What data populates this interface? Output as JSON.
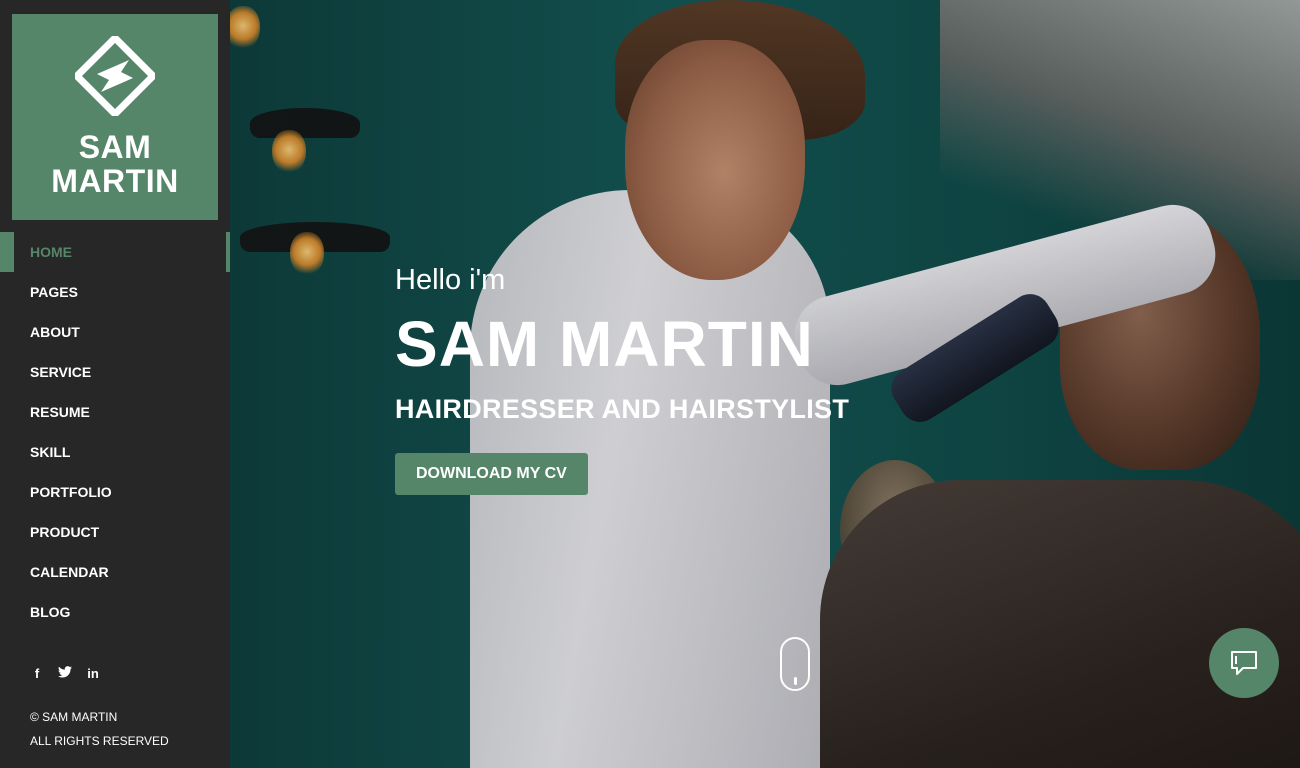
{
  "brand": {
    "name_line1": "SAM",
    "name_line2": "MARTIN",
    "logo_icon": "diamond-s-logo-icon",
    "accent_color": "#568669"
  },
  "nav": {
    "items": [
      {
        "label": "HOME",
        "active": true
      },
      {
        "label": "PAGES",
        "active": false
      },
      {
        "label": "ABOUT",
        "active": false
      },
      {
        "label": "SERVICE",
        "active": false
      },
      {
        "label": "RESUME",
        "active": false
      },
      {
        "label": "SKILL",
        "active": false
      },
      {
        "label": "PORTFOLIO",
        "active": false
      },
      {
        "label": "PRODUCT",
        "active": false
      },
      {
        "label": "CALENDAR",
        "active": false
      },
      {
        "label": "BLOG",
        "active": false
      }
    ]
  },
  "social": {
    "facebook": "f",
    "twitter_icon": "twitter-icon",
    "linkedin": "in"
  },
  "footer": {
    "copyright": "© SAM MARTIN",
    "rights": "ALL RIGHTS RESERVED"
  },
  "hero": {
    "greeting": "Hello i'm",
    "name": "SAM MARTIN",
    "subtitle": "HAIRDRESSER AND HAIRSTYLIST",
    "cta_label": "DOWNLOAD MY CV"
  },
  "widgets": {
    "scroll_icon": "mouse-scroll-icon",
    "chat_icon": "chat-bubble-icon"
  }
}
